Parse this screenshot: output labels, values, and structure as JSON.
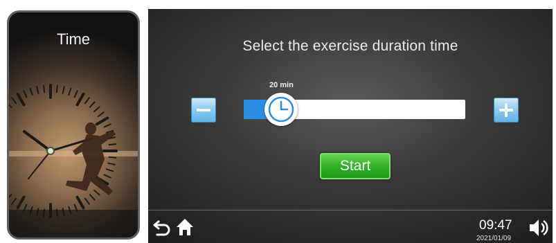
{
  "card": {
    "title": "Time",
    "icon": "running-clock-icon"
  },
  "duration_screen": {
    "prompt": "Select the exercise duration time",
    "slider": {
      "value_label": "20 min",
      "value_fraction": 0.17
    },
    "start_label": "Start",
    "colors": {
      "accent": "#2b8de3",
      "start": "#35b42a"
    }
  },
  "bottom_bar": {
    "time": "09:47",
    "date": "2021/01/09",
    "icons": [
      "back-icon",
      "home-icon",
      "volume-icon"
    ]
  }
}
